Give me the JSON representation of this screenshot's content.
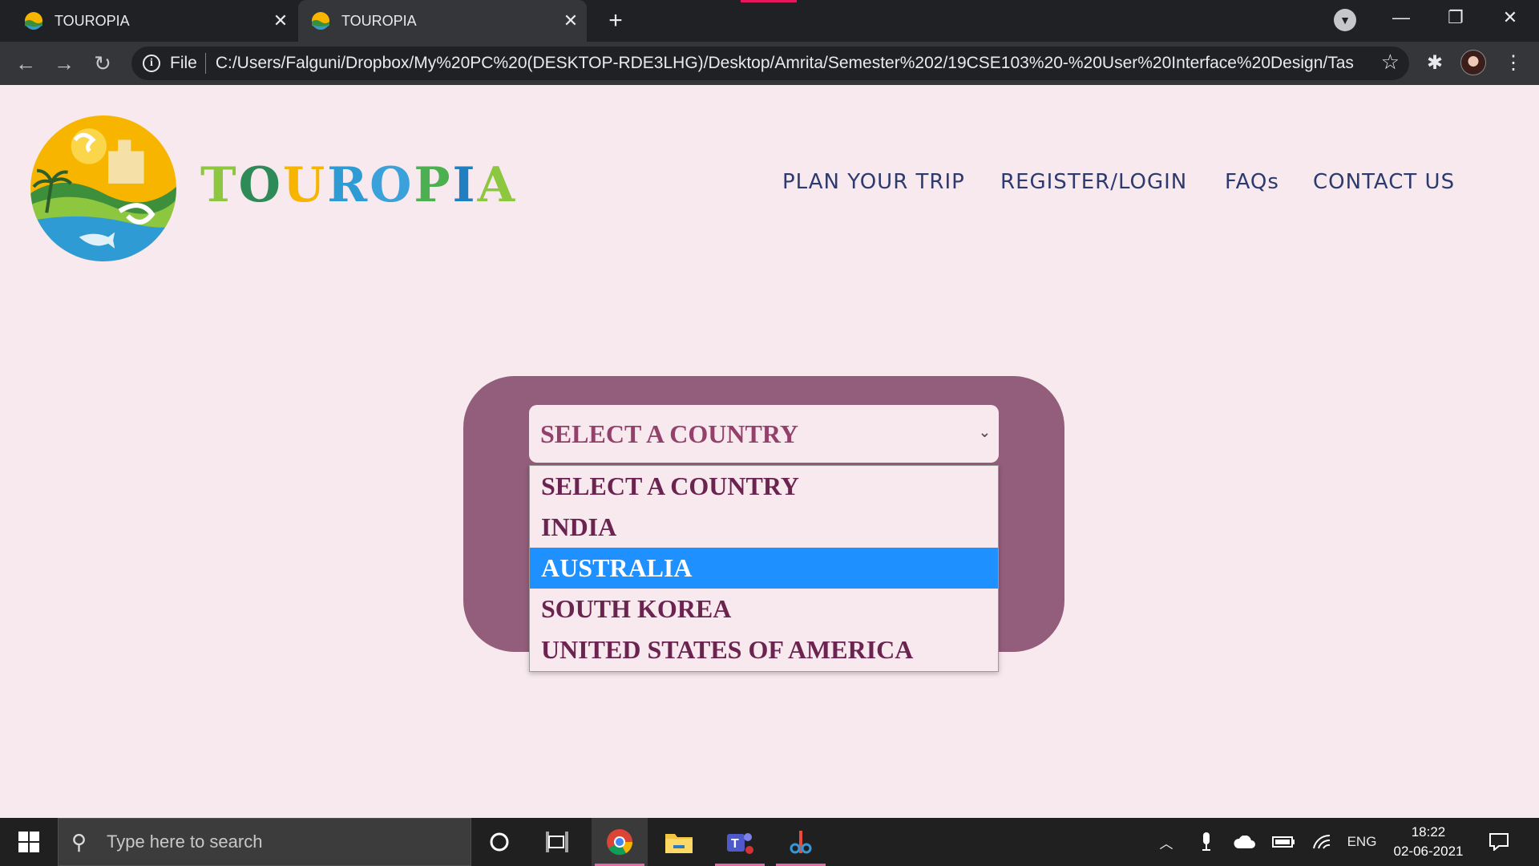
{
  "browser": {
    "tabs": [
      {
        "title": "TOUROPIA",
        "active": false
      },
      {
        "title": "TOUROPIA",
        "active": true
      }
    ],
    "new_tab_label": "+",
    "address": {
      "scheme_label": "File",
      "url": "C:/Users/Falguni/Dropbox/My%20PC%20(DESKTOP-RDE3LHG)/Desktop/Amrita/Semester%202/19CSE103%20-%20User%20Interface%20Design/Task%2..."
    }
  },
  "site": {
    "brand_letters": [
      "T",
      "O",
      "U",
      "R",
      "O",
      "P",
      "I",
      "A",
      ""
    ],
    "nav": [
      "PLAN YOUR TRIP",
      "REGISTER/LOGIN",
      "FAQs",
      "CONTACT US"
    ]
  },
  "country_select": {
    "value": "SELECT A COUNTRY",
    "options": [
      "SELECT A COUNTRY",
      "INDIA",
      "AUSTRALIA",
      "SOUTH KOREA",
      "UNITED STATES OF AMERICA"
    ],
    "highlighted": "AUSTRALIA"
  },
  "taskbar": {
    "search_placeholder": "Type here to search",
    "language": "ENG",
    "time": "18:22",
    "date": "02-06-2021"
  },
  "colors": {
    "page_bg": "#f7e9ee",
    "card_bg": "#935e7b",
    "nav_text": "#2d3a6e",
    "select_text": "#93406b",
    "highlight": "#1e90ff"
  }
}
